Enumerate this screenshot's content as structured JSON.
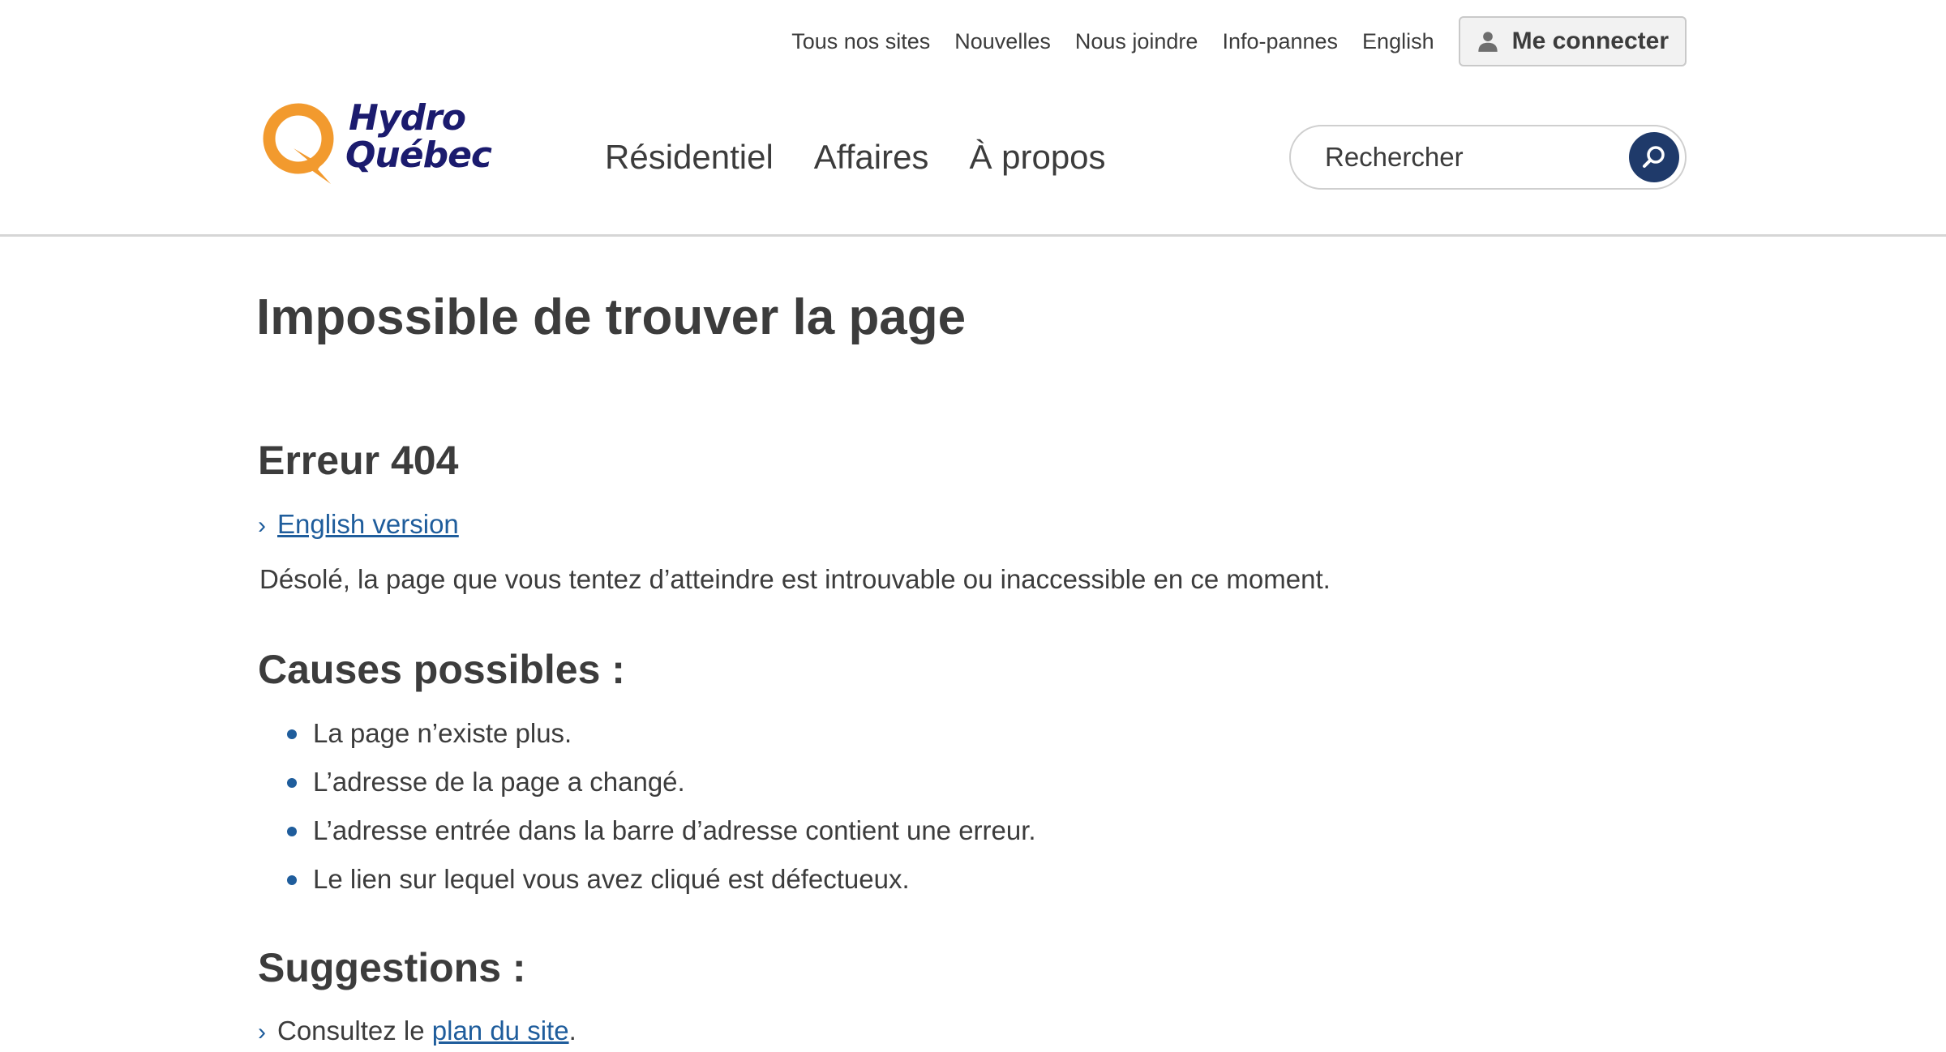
{
  "utility_nav": {
    "items": [
      "Tous nos sites",
      "Nouvelles",
      "Nous joindre",
      "Info-pannes",
      "English"
    ],
    "login_label": "Me connecter"
  },
  "logo": {
    "line1": "Hydro",
    "line2": "Québec",
    "colors": {
      "q_orange": "#f29a2e",
      "text_navy": "#1b1b6e"
    }
  },
  "main_nav": {
    "items": [
      "Résidentiel",
      "Affaires",
      "À propos"
    ]
  },
  "search": {
    "placeholder": "Rechercher",
    "button_icon": "search-icon",
    "button_color": "#1f3a6a"
  },
  "content": {
    "title": "Impossible de trouver la page",
    "error_heading": "Erreur 404",
    "english_link": "English version",
    "sorry_text": "Désolé, la page que vous tentez d’atteindre est introuvable ou inaccessible en ce moment.",
    "causes_heading": "Causes possibles :",
    "causes": [
      "La page n’existe plus.",
      "L’adresse de la page a changé.",
      "L’adresse entrée dans la barre d’adresse contient une erreur.",
      "Le lien sur lequel vous avez cliqué est défectueux."
    ],
    "suggestions_heading": "Suggestions :",
    "suggestion_prefix": "Consultez le ",
    "suggestion_link": "plan du site",
    "suggestion_suffix": "."
  },
  "colors": {
    "link": "#1f5d9c",
    "text": "#3c3c3c",
    "divider": "#d6d6d6"
  }
}
